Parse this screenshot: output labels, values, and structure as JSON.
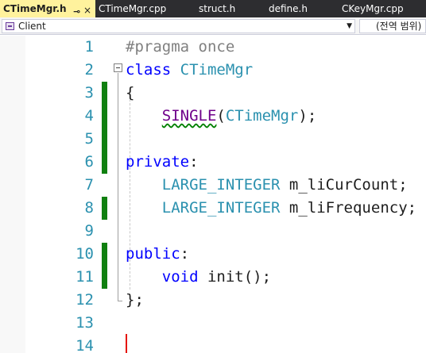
{
  "tabs": [
    {
      "label": "CTimeMgr.h",
      "active": true
    },
    {
      "label": "CTimeMgr.cpp",
      "active": false
    },
    {
      "label": "struct.h",
      "active": false
    },
    {
      "label": "define.h",
      "active": false
    },
    {
      "label": "CKeyMgr.cpp",
      "active": false
    }
  ],
  "tab_icons": {
    "pin": "⊸",
    "close": "×"
  },
  "nav": {
    "project": "Client",
    "scope": "(전역 범위)",
    "dropdown_glyph": "▼"
  },
  "editor": {
    "line_numbers": [
      "1",
      "2",
      "3",
      "4",
      "5",
      "6",
      "7",
      "8",
      "9",
      "10",
      "11",
      "12",
      "13",
      "14"
    ],
    "lines": [
      {
        "pp": "#pragma once"
      },
      {
        "kw": "class",
        "sp": " ",
        "ty": "CTimeMgr"
      },
      {
        "p": "{"
      },
      {
        "ind": "    ",
        "mc": "SINGLE",
        "p1": "(",
        "ty": "CTimeMgr",
        "p2": ");"
      },
      {},
      {
        "kw": "private",
        "p": ":"
      },
      {
        "ind": "    ",
        "ty": "LARGE_INTEGER",
        "id": " m_liCurCount;"
      },
      {
        "ind": "    ",
        "ty": "LARGE_INTEGER",
        "id": " m_liFrequency;"
      },
      {},
      {
        "kw": "public",
        "p": ":"
      },
      {
        "ind": "    ",
        "kw": "void",
        "id": " init();"
      },
      {
        "p": "};"
      },
      {},
      {}
    ]
  },
  "colors": {
    "tab_active_bg": "#fff29d",
    "tabbar_bg": "#2d2d30",
    "keyword": "#0000ff",
    "type": "#2b91af",
    "macro": "#6f008a",
    "preprocessor": "#808080",
    "change_bar": "#108010",
    "caret": "#e51400"
  }
}
